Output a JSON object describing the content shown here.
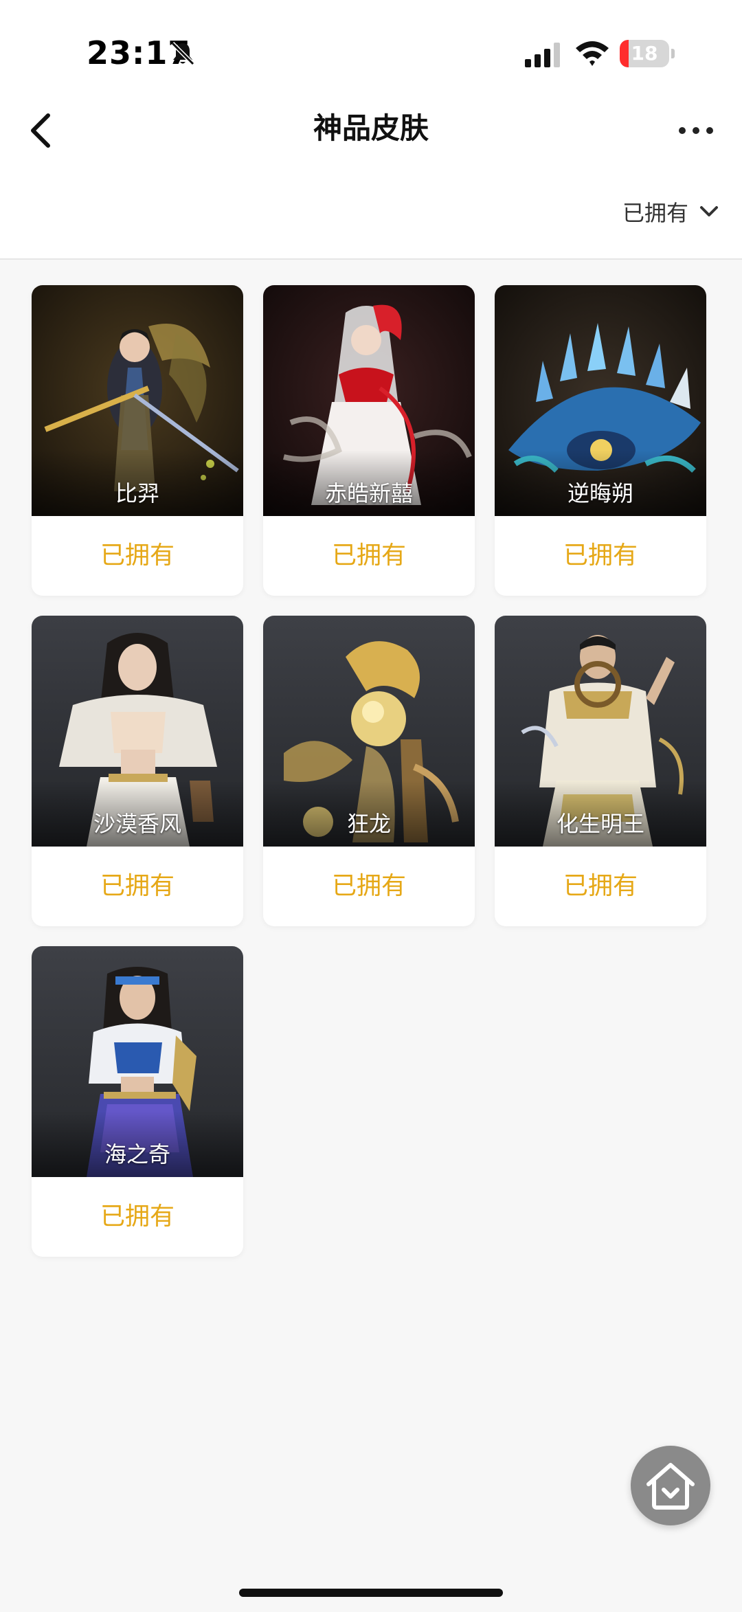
{
  "status_bar": {
    "time": "23:17",
    "battery_level": "18",
    "battery_fraction": 0.18,
    "icons": [
      "bell-slash-icon",
      "signal-icon",
      "wifi-icon",
      "battery-icon"
    ]
  },
  "nav": {
    "title": "神品皮肤",
    "back_icon": "chevron-left-icon",
    "more_icon": "ellipsis-icon"
  },
  "filter": {
    "label": "已拥有",
    "icon": "chevron-down-icon"
  },
  "colors": {
    "owned_text": "#e6a817",
    "background": "#f7f7f7"
  },
  "skins": [
    {
      "name": "比羿",
      "status": "已拥有",
      "art": "warrior-gold"
    },
    {
      "name": "赤皓新囍",
      "status": "已拥有",
      "art": "bride-red"
    },
    {
      "name": "逆晦朔",
      "status": "已拥有",
      "art": "crystal-eye"
    },
    {
      "name": "沙漠香风",
      "status": "已拥有",
      "art": "desert-lady"
    },
    {
      "name": "狂龙",
      "status": "已拥有",
      "art": "golden-dragon"
    },
    {
      "name": "化生明王",
      "status": "已拥有",
      "art": "monk-warrior"
    },
    {
      "name": "海之奇",
      "status": "已拥有",
      "art": "sea-pirate"
    }
  ],
  "floating_button": {
    "icon": "home-icon"
  }
}
